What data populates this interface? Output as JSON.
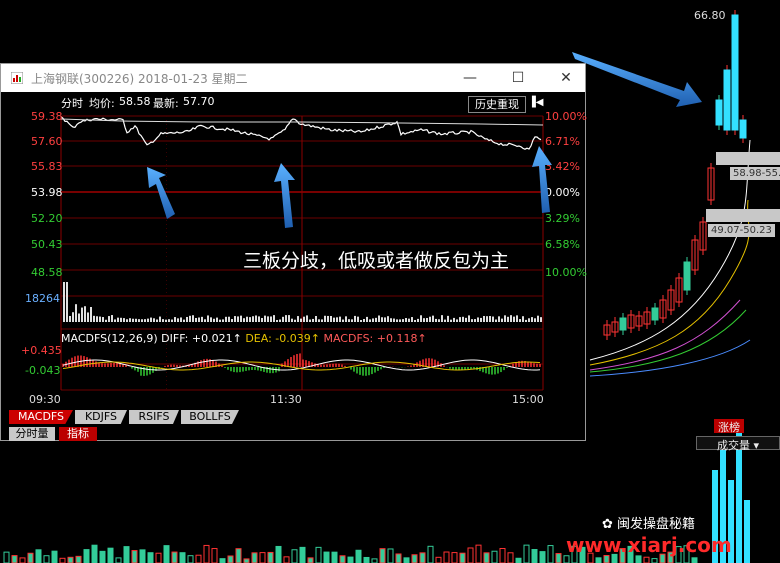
{
  "background": {
    "max_price_label": "66.80",
    "grey_tags": [
      "58.98",
      "55.1",
      "49.07",
      "50.23"
    ],
    "rank_button": "涨榜",
    "volume_selector": "成交量",
    "watermark": "www.xiarj.com",
    "wechat_label": "闽发操盘秘籍"
  },
  "window": {
    "title": "上海钢联(300226) 2018-01-23 星期二",
    "buttons": {
      "minimize": "—",
      "maximize": "☐",
      "close": "✕"
    },
    "info": {
      "label_time": "分时",
      "avg_label": "均价:",
      "avg_value": "58.58",
      "latest_label": "最新:",
      "latest_value": "57.70"
    },
    "history_button": "历史重现",
    "y_left": [
      "59.38",
      "57.60",
      "55.83",
      "53.98",
      "52.20",
      "50.43",
      "48.58"
    ],
    "y_right": [
      "10.00%",
      "6.71%",
      "3.42%",
      "0.00%",
      "3.29%",
      "6.58%",
      "10.00%"
    ],
    "volume_max": "18264",
    "macd": {
      "name": "MACDFS(12,26,9)",
      "diff": "DIFF: +0.021↑",
      "dea": "DEA: -0.039↑",
      "macdfs": "MACDFS: +0.118↑",
      "y_top": "+0.435",
      "y_mid": "-0.043"
    },
    "x_labels": [
      "09:30",
      "11:30",
      "15:00"
    ],
    "tabs": [
      "MACDFS",
      "KDJFS",
      "RSIFS",
      "BOLLFS"
    ],
    "active_tab": "MACDFS",
    "bottom_tabs": [
      "分时量",
      "指标"
    ],
    "annotation": "三板分歧，低吸或者做反包为主"
  },
  "colors": {
    "up": "#ff3333",
    "down": "#33cc33",
    "accent_arrow": "#2b7fd6",
    "grid": "#8b0000"
  }
}
